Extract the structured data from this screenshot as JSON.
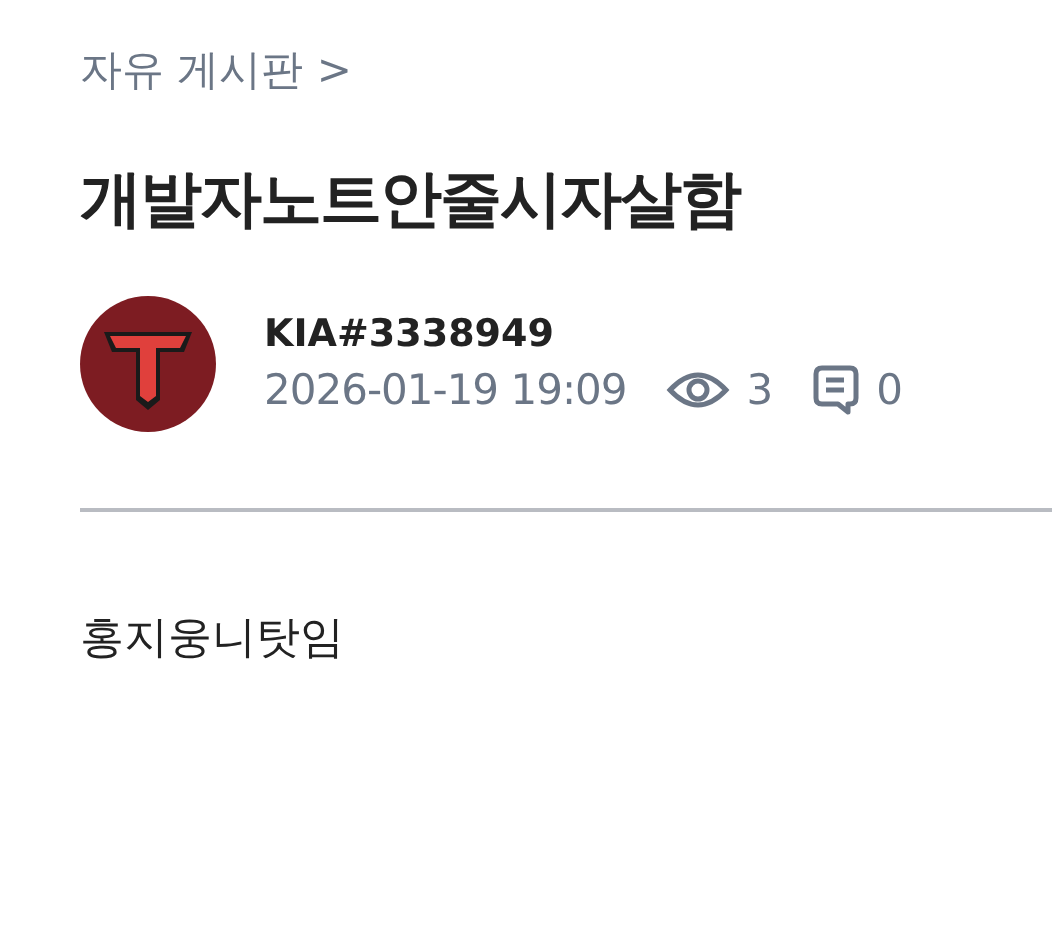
{
  "breadcrumb": {
    "label": "자유 게시판",
    "arrow": ">"
  },
  "title": "개발자노트안줄시자살함",
  "author": {
    "name": "KIA#3338949",
    "date": "2026-01-19 19:09",
    "views": "3",
    "comments": "0"
  },
  "body": "홍지웅니탓임"
}
